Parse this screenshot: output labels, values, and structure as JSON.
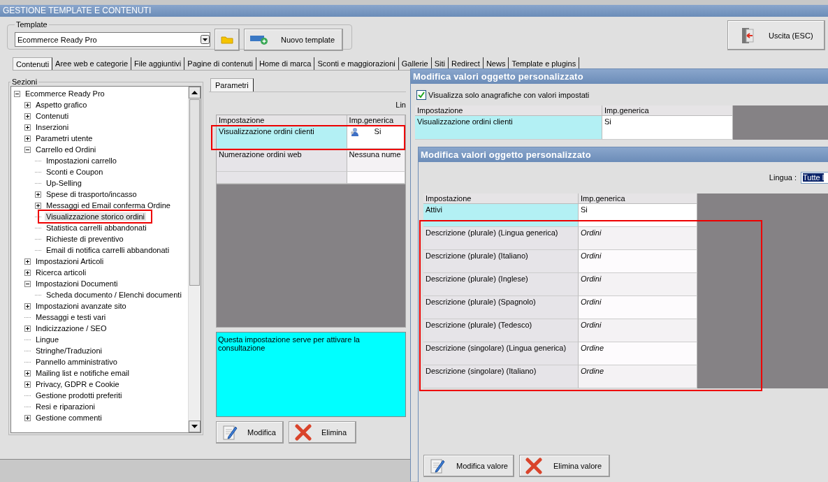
{
  "window": {
    "title": "GESTIONE TEMPLATE E CONTENUTI"
  },
  "template": {
    "label": "Template",
    "value": "Ecommerce Ready Pro",
    "new_button": "Nuovo template"
  },
  "exit_button": "Uscita (ESC)",
  "tabs": [
    {
      "label": "Contenuti",
      "selected": true
    },
    {
      "label": "Aree web e categorie",
      "selected": false
    },
    {
      "label": "File aggiuntivi",
      "selected": false
    },
    {
      "label": "Pagine di contenuti",
      "selected": false
    },
    {
      "label": "Home di marca",
      "selected": false
    },
    {
      "label": "Sconti e maggiorazioni",
      "selected": false
    },
    {
      "label": "Gallerie",
      "selected": false
    },
    {
      "label": "Siti",
      "selected": false
    },
    {
      "label": "Redirect",
      "selected": false
    },
    {
      "label": "News",
      "selected": false
    },
    {
      "label": "Template e plugins",
      "selected": false
    }
  ],
  "sections": {
    "label": "Sezioni",
    "tree": [
      {
        "label": "Ecommerce Ready Pro",
        "expanded": true,
        "selected": false,
        "highlighted": false,
        "children": [
          {
            "label": "Aspetto grafico",
            "expanded": false,
            "selected": false,
            "highlighted": false
          },
          {
            "label": "Contenuti",
            "expanded": false,
            "selected": false,
            "highlighted": false
          },
          {
            "label": "Inserzioni",
            "expanded": false,
            "selected": false,
            "highlighted": false
          },
          {
            "label": "Parametri utente",
            "expanded": false,
            "selected": false,
            "highlighted": false
          },
          {
            "label": "Carrello ed Ordini",
            "expanded": true,
            "selected": false,
            "highlighted": false,
            "children": [
              {
                "label": "Impostazioni carrello",
                "selected": false,
                "highlighted": false
              },
              {
                "label": "Sconti e Coupon",
                "selected": false,
                "highlighted": false
              },
              {
                "label": "Up-Selling",
                "selected": false,
                "highlighted": false
              },
              {
                "label": "Spese di trasporto/incasso",
                "expanded": false,
                "selected": false,
                "highlighted": false
              },
              {
                "label": "Messaggi ed Email conferma Ordine",
                "expanded": false,
                "selected": false,
                "highlighted": false
              },
              {
                "label": "Visualizzazione storico ordini",
                "selected": true,
                "highlighted": true
              },
              {
                "label": "Statistica carrelli abbandonati",
                "selected": false,
                "highlighted": false
              },
              {
                "label": "Richieste di preventivo",
                "selected": false,
                "highlighted": false
              },
              {
                "label": "Email di notifica carrelli abbandonati",
                "selected": false,
                "highlighted": false
              }
            ]
          },
          {
            "label": "Impostazioni Articoli",
            "expanded": false,
            "selected": false,
            "highlighted": false
          },
          {
            "label": "Ricerca articoli",
            "expanded": false,
            "selected": false,
            "highlighted": false
          },
          {
            "label": "Impostazioni Documenti",
            "expanded": true,
            "selected": false,
            "highlighted": false,
            "children": [
              {
                "label": "Scheda documento / Elenchi documenti",
                "selected": false,
                "highlighted": false
              }
            ]
          },
          {
            "label": "Impostazioni avanzate sito",
            "expanded": false,
            "selected": false,
            "highlighted": false
          },
          {
            "label": "Messaggi e testi vari",
            "selected": false,
            "highlighted": false
          },
          {
            "label": "Indicizzazione / SEO",
            "expanded": false,
            "selected": false,
            "highlighted": false
          },
          {
            "label": "Lingue",
            "selected": false,
            "highlighted": false
          },
          {
            "label": "Stringhe/Traduzioni",
            "selected": false,
            "highlighted": false
          },
          {
            "label": "Pannello amministrativo",
            "selected": false,
            "highlighted": false
          },
          {
            "label": "Mailing list e notifiche email",
            "expanded": false,
            "selected": false,
            "highlighted": false
          },
          {
            "label": "Privacy, GDPR e Cookie",
            "expanded": false,
            "selected": false,
            "highlighted": false
          },
          {
            "label": "Gestione prodotti preferiti",
            "selected": false,
            "highlighted": false
          },
          {
            "label": "Resi e riparazioni",
            "selected": false,
            "highlighted": false
          },
          {
            "label": "Gestione commenti",
            "expanded": false,
            "selected": false,
            "highlighted": false
          }
        ]
      }
    ]
  },
  "parameters": {
    "tab": {
      "label": "Parametri",
      "selected": true
    },
    "language_label": "Lin",
    "table": {
      "columns": [
        "Impostazione",
        "Imp.generica"
      ],
      "rows": [
        {
          "cells": [
            "Visualizzazione ordini clienti",
            "Si"
          ],
          "selected": true,
          "highlighted": true,
          "has_icon": true
        },
        {
          "cells": [
            "Numerazione ordini web",
            "Nessuna nume"
          ],
          "selected": false,
          "highlighted": false,
          "has_icon": false
        }
      ]
    },
    "description": "Questa impostazione serve per attivare la consultazione",
    "buttons": [
      {
        "label": "Modifica",
        "kind": "edit"
      },
      {
        "label": "Elimina",
        "kind": "delete"
      }
    ]
  },
  "dialog_filter": {
    "title": "Modifica valori oggetto personalizzato",
    "checkbox": {
      "label": "Visualizza solo anagrafiche con valori impostati",
      "checked": true
    },
    "table": {
      "columns": [
        "Impostazione",
        "Imp.generica"
      ],
      "rows": [
        {
          "cells": [
            "Visualizzazione ordini clienti",
            "Si"
          ],
          "selected": true
        }
      ]
    }
  },
  "dialog_values": {
    "title": "Modifica valori oggetto personalizzato",
    "language": {
      "label": "Lingua :",
      "value": "Tutte l"
    },
    "table": {
      "columns": [
        "Impostazione",
        "Imp.generica"
      ],
      "rows": [
        {
          "cells": [
            "Attivi",
            "Si"
          ],
          "selected": true,
          "highlighted": false,
          "italic_value": false
        },
        {
          "cells": [
            "Descrizione (plurale) (Lingua generica)",
            "Ordini"
          ],
          "selected": false,
          "highlighted": true,
          "italic_value": true
        },
        {
          "cells": [
            "Descrizione (plurale) (Italiano)",
            "Ordini"
          ],
          "selected": false,
          "highlighted": true,
          "italic_value": true
        },
        {
          "cells": [
            "Descrizione (plurale) (Inglese)",
            "Ordini"
          ],
          "selected": false,
          "highlighted": true,
          "italic_value": true
        },
        {
          "cells": [
            "Descrizione (plurale) (Spagnolo)",
            "Ordini"
          ],
          "selected": false,
          "highlighted": true,
          "italic_value": true
        },
        {
          "cells": [
            "Descrizione (plurale) (Tedesco)",
            "Ordini"
          ],
          "selected": false,
          "highlighted": true,
          "italic_value": true
        },
        {
          "cells": [
            "Descrizione (singolare) (Lingua generica)",
            "Ordine"
          ],
          "selected": false,
          "highlighted": true,
          "italic_value": true
        },
        {
          "cells": [
            "Descrizione (singolare) (Italiano)",
            "Ordine"
          ],
          "selected": false,
          "highlighted": true,
          "italic_value": true
        }
      ]
    },
    "buttons": [
      {
        "label": "Modifica valore",
        "kind": "edit"
      },
      {
        "label": "Elimina valore",
        "kind": "delete"
      }
    ]
  }
}
